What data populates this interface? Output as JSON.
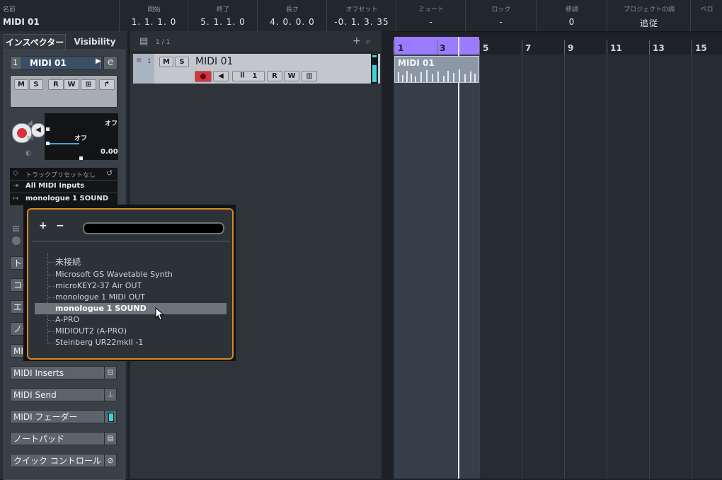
{
  "info_line": {
    "name_label": "名前",
    "name_value": "MIDI 01",
    "columns": [
      {
        "label": "開始",
        "value": "1. 1. 1.   0"
      },
      {
        "label": "終了",
        "value": "5. 1. 1.   0"
      },
      {
        "label": "長さ",
        "value": "4. 0. 0.   0"
      },
      {
        "label": "オフセット",
        "value": "-0. 1. 3. 35"
      },
      {
        "label": "ミュート",
        "value": "-"
      },
      {
        "label": "ロック",
        "value": "-"
      },
      {
        "label": "移調",
        "value": "0"
      },
      {
        "label": "プロジェクトの調",
        "value": "追従"
      },
      {
        "label": "ベロ",
        "value": ""
      }
    ]
  },
  "inspector": {
    "tabs": [
      "インスペクター",
      "Visibility"
    ],
    "track_number": "1",
    "track_name": "MIDI 01",
    "buttons": {
      "mute": "M",
      "solo": "S",
      "read": "R",
      "write": "W"
    },
    "volume_value": "オフ",
    "pan_value": "オフ",
    "delay_value": "0.00",
    "preset_label": "トラックプリセットなし",
    "input_routing": "All MIDI Inputs",
    "output_routing": "monologue 1 SOUND",
    "sections": [
      {
        "label": "トラ"
      },
      {
        "label": "コー"
      },
      {
        "label": "エ"
      },
      {
        "label": "ノー"
      },
      {
        "label": "MI"
      },
      {
        "label": "MIDI Inserts"
      },
      {
        "label": "MIDI Send"
      },
      {
        "label": "MIDI フェーダー"
      },
      {
        "label": "ノートパッド"
      },
      {
        "label": "クイック コントロール"
      }
    ]
  },
  "track_list": {
    "counter": "1 / 1",
    "track": {
      "number": "1",
      "name": "MIDI 01",
      "channel": "1"
    }
  },
  "ruler": {
    "bars": [
      "1",
      "3",
      "5",
      "7",
      "9",
      "11",
      "13",
      "15"
    ]
  },
  "event": {
    "name": "MIDI 01"
  },
  "popup": {
    "add": "+",
    "remove": "−",
    "search_value": "",
    "items": [
      "未接続",
      "Microsoft GS Wavetable Synth",
      "microKEY2-37 Air OUT",
      "monologue 1 MIDI OUT",
      "monologue 1 SOUND",
      "A-PRO",
      "MIDIOUT2 (A-PRO)",
      "Steinberg UR22mkII -1"
    ],
    "selected_index": 4
  },
  "colors": {
    "accent_orange": "#d58a1e",
    "cycle_purple": "#9b7bff",
    "meter_cyan": "#35d5e0",
    "record_red": "#d8323f"
  }
}
